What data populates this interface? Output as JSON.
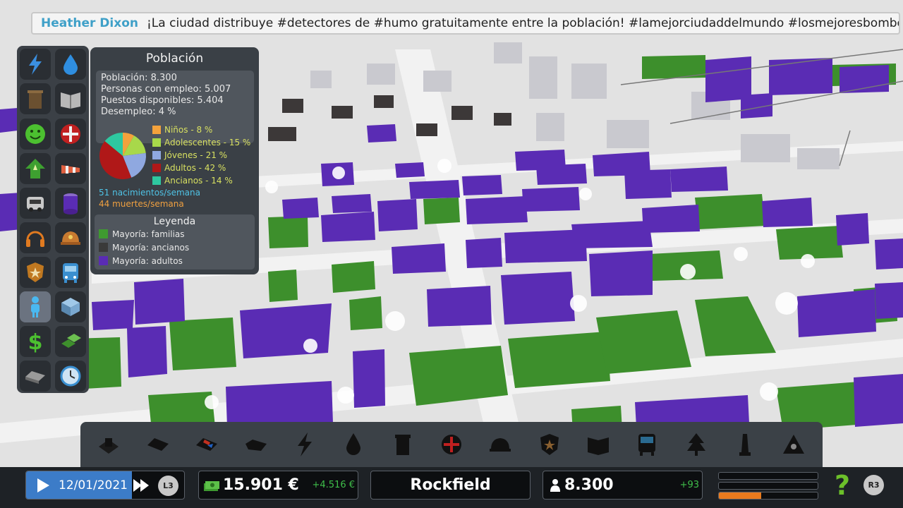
{
  "chirper": {
    "author": "Heather Dixon",
    "message": "¡La ciudad distribuye #detectores de #humo gratuitamente entre la población! #lamejorciudaddelmundo #losmejoresbomberos"
  },
  "info_panel": {
    "buttons": [
      {
        "name": "electricity-icon"
      },
      {
        "name": "water-icon"
      },
      {
        "name": "garbage-icon"
      },
      {
        "name": "education-icon"
      },
      {
        "name": "happiness-icon"
      },
      {
        "name": "health-icon"
      },
      {
        "name": "land-value-icon"
      },
      {
        "name": "pollution-icon"
      },
      {
        "name": "traffic-icon"
      },
      {
        "name": "resources-icon"
      },
      {
        "name": "noise-icon"
      },
      {
        "name": "fire-icon"
      },
      {
        "name": "crime-icon"
      },
      {
        "name": "transport-icon"
      },
      {
        "name": "population-icon"
      },
      {
        "name": "buildings-icon"
      },
      {
        "name": "money-icon"
      },
      {
        "name": "zoning-icon"
      },
      {
        "name": "roads-icon"
      },
      {
        "name": "clock-icon"
      }
    ]
  },
  "population_panel": {
    "title": "Población",
    "stats": {
      "population": "Población: 8.300",
      "employed": "Personas con empleo: 5.007",
      "jobs": "Puestos disponibles: 5.404",
      "unemployment": "Desempleo: 4 %"
    },
    "age_groups": [
      {
        "label": "Niños - 8 %",
        "value": 8,
        "color": "#f4a23c"
      },
      {
        "label": "Adolescentes - 15 %",
        "value": 15,
        "color": "#a8d84a"
      },
      {
        "label": "Jóvenes - 21 %",
        "value": 21,
        "color": "#8fa8e0"
      },
      {
        "label": "Adultos - 42 %",
        "value": 42,
        "color": "#b01818"
      },
      {
        "label": "Ancianos - 14 %",
        "value": 14,
        "color": "#2ec8a0"
      }
    ],
    "births": "51 nacimientos/semana",
    "deaths": "44 muertes/semana",
    "legend": {
      "title": "Leyenda",
      "items": [
        {
          "label": "Mayoría: familias",
          "color": "#3f9a30"
        },
        {
          "label": "Mayoría: ancianos",
          "color": "#3a3a3a"
        },
        {
          "label": "Mayoría: adultos",
          "color": "#5a2cb4"
        }
      ]
    }
  },
  "toolbar": {
    "tools": [
      {
        "name": "zoning-tool-icon"
      },
      {
        "name": "roads-tool-icon"
      },
      {
        "name": "districts-tool-icon"
      },
      {
        "name": "areas-tool-icon"
      },
      {
        "name": "electricity-tool-icon"
      },
      {
        "name": "water-tool-icon"
      },
      {
        "name": "garbage-tool-icon"
      },
      {
        "name": "health-tool-icon"
      },
      {
        "name": "fire-tool-icon"
      },
      {
        "name": "police-tool-icon"
      },
      {
        "name": "education-tool-icon"
      },
      {
        "name": "transport-tool-icon"
      },
      {
        "name": "parks-tool-icon"
      },
      {
        "name": "monuments-tool-icon"
      },
      {
        "name": "landscaping-tool-icon"
      }
    ]
  },
  "status": {
    "date": "12/01/2021",
    "speed_button": "L3",
    "money": "15.901 €",
    "money_delta": "+4.516 €",
    "city_name": "Rockfield",
    "population": "8.300",
    "population_delta": "+93",
    "help_button": "R3",
    "demand_meters": [
      0,
      0,
      0.43
    ]
  }
}
